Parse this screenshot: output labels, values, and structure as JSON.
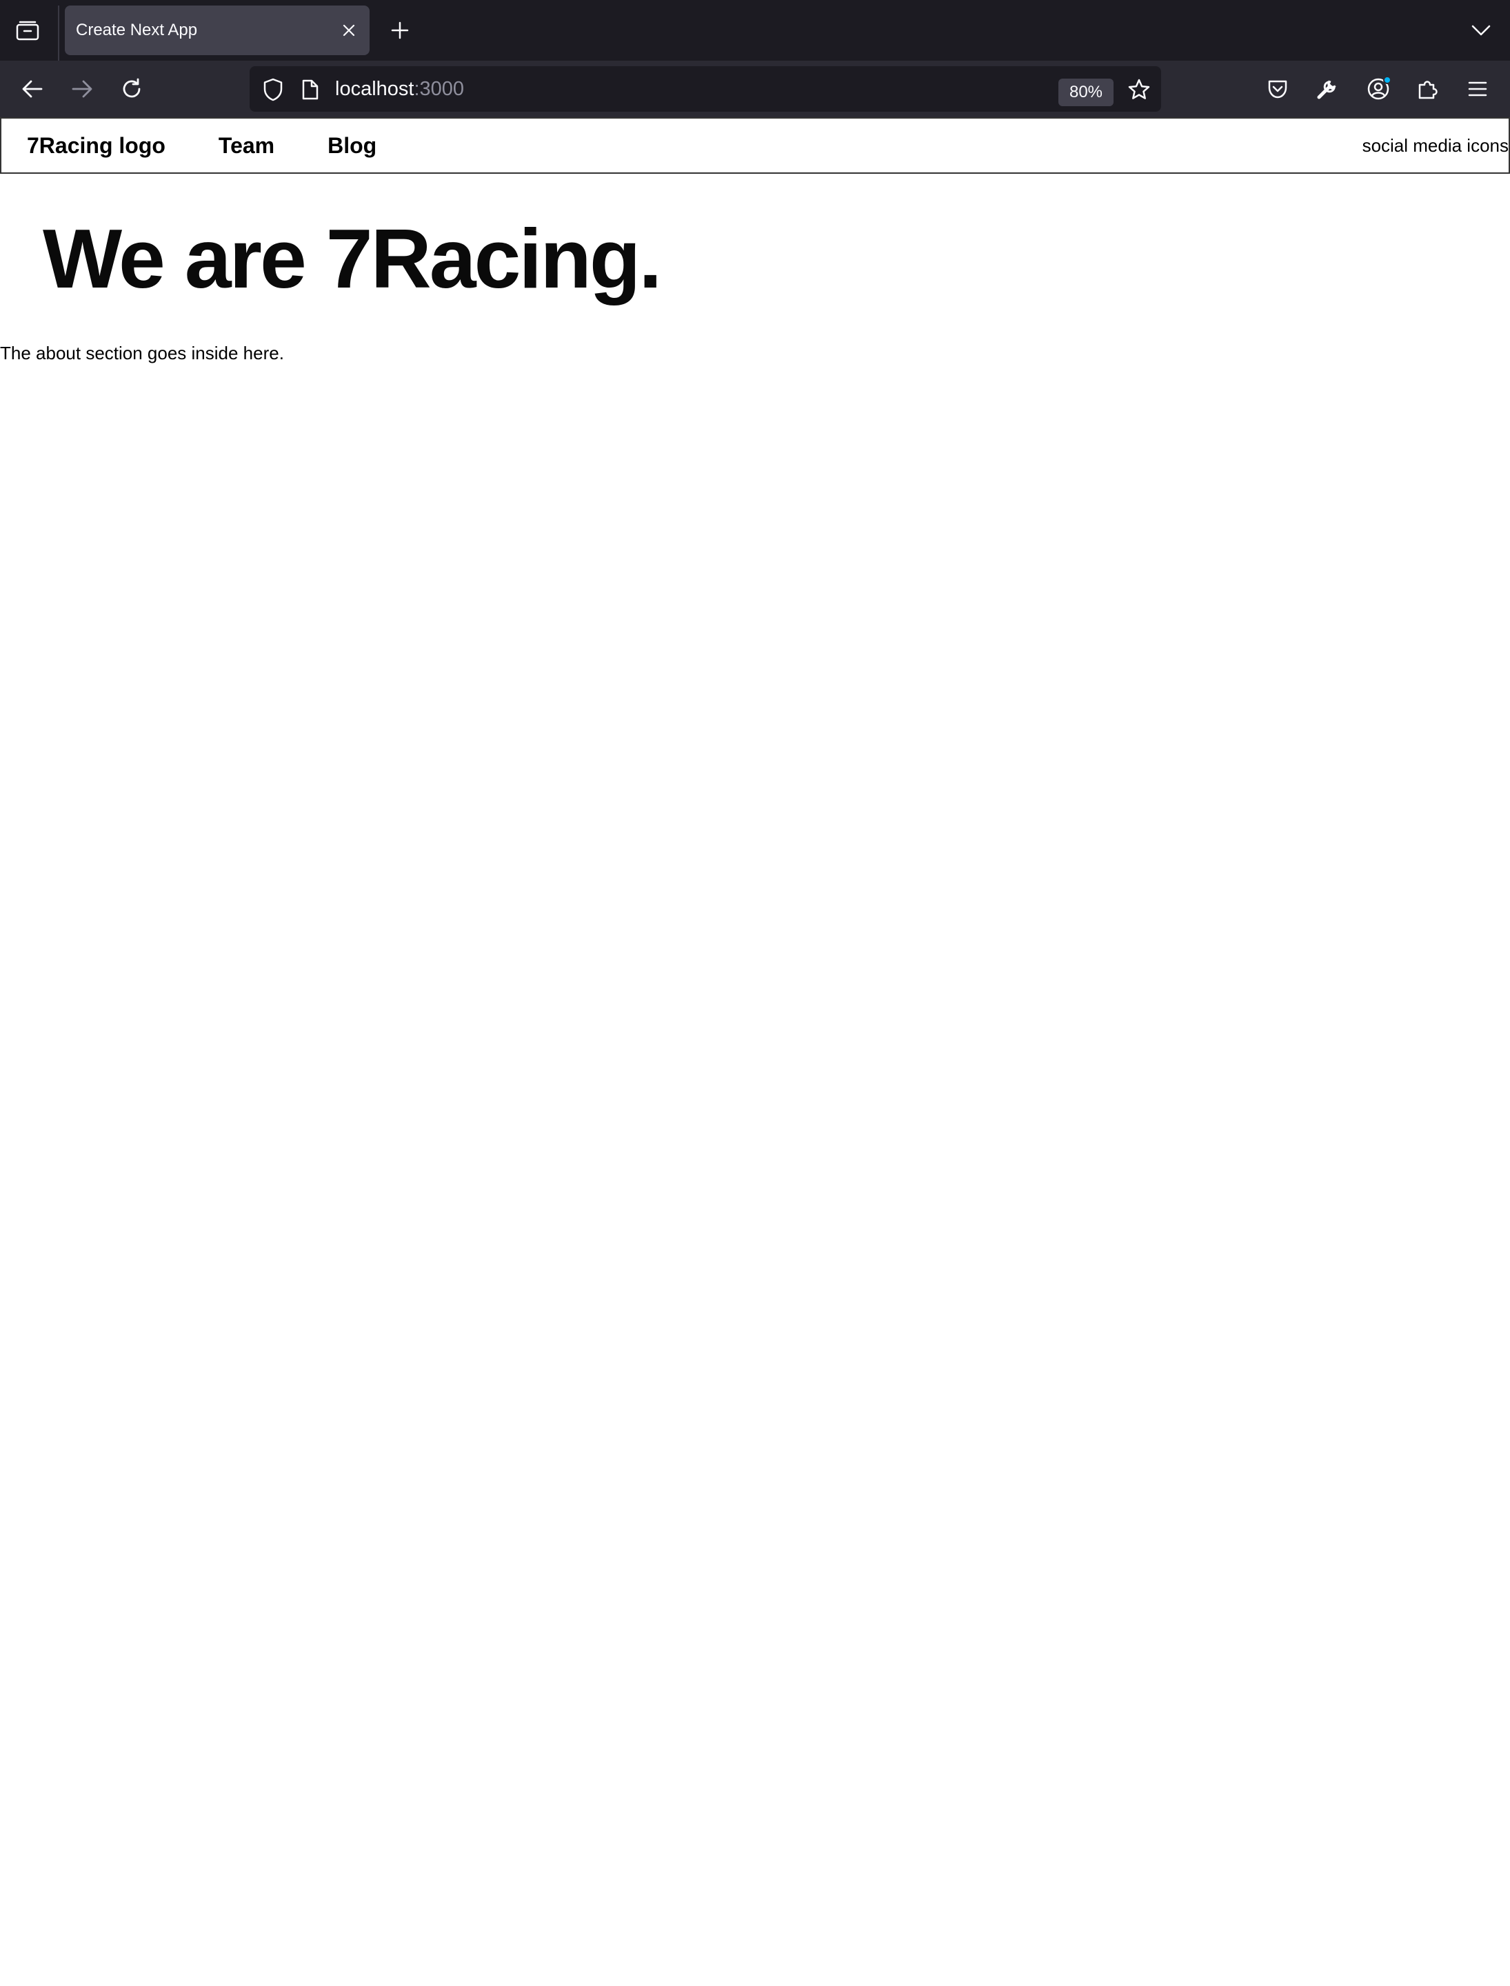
{
  "browser": {
    "tab": {
      "title": "Create Next App"
    },
    "url": {
      "host": "localhost",
      "port": ":3000"
    },
    "zoom": "80%",
    "icons": {
      "tab_overview": "tab-overview-icon",
      "tab_close": "close-icon",
      "new_tab": "plus-icon",
      "tab_list": "chevron-down-icon",
      "back": "arrow-left-icon",
      "forward": "arrow-right-icon",
      "reload": "reload-icon",
      "shield": "shield-icon",
      "page": "page-icon",
      "bookmark": "star-icon",
      "pocket": "pocket-icon",
      "tools": "wrench-icon",
      "account": "account-icon",
      "extensions": "puzzle-icon",
      "menu": "hamburger-menu-icon"
    },
    "colors": {
      "tabbar_bg": "#1c1b22",
      "toolbar_bg": "#2b2a33",
      "active_tab_bg": "#42414d",
      "accent_dot": "#00b3f4"
    }
  },
  "site": {
    "header": {
      "logo_label": "7Racing logo",
      "nav": [
        "Team",
        "Blog"
      ],
      "social_label": "social media icons"
    },
    "hero": {
      "title": "We are 7Racing."
    },
    "about": {
      "text": "The about section goes inside here."
    }
  }
}
